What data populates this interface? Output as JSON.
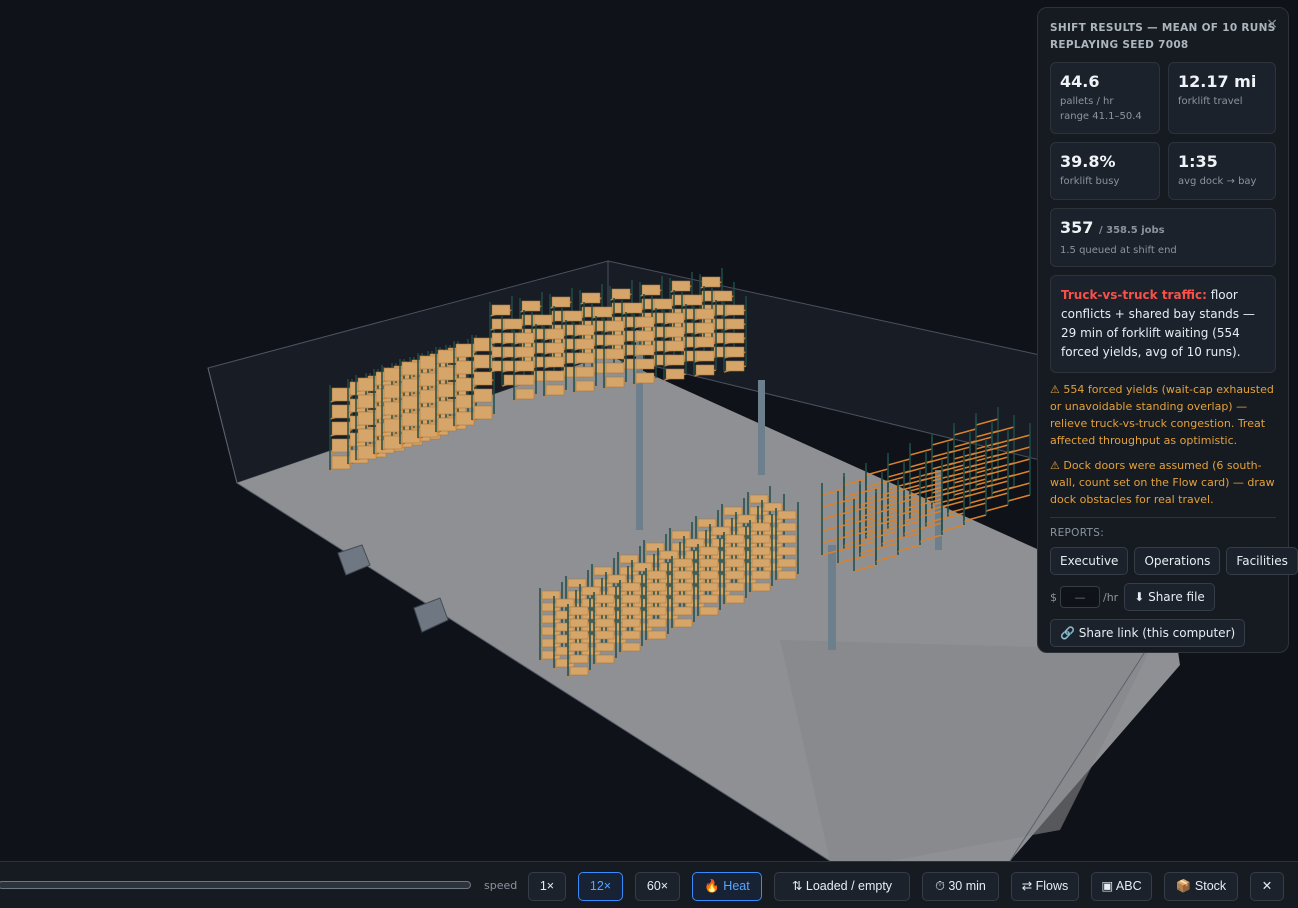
{
  "panel": {
    "close_label": "×",
    "title_line1": "SHIFT RESULTS — MEAN OF 10 RUNS",
    "title_line2": "REPLAYING SEED 7008",
    "stats": {
      "pallets_value": "44.6",
      "pallets_label": "pallets / hr",
      "pallets_range": "range 41.1–50.4",
      "travel_value": "12.17 mi",
      "travel_label": "forklift travel",
      "busy_value": "39.8%",
      "busy_label": "forklift busy",
      "dock_value": "1:35",
      "dock_label": "avg dock → bay",
      "jobs_value": "357",
      "jobs_total": "/ 358.5 jobs",
      "jobs_queued": "1.5 queued at shift end"
    },
    "traffic_heading": "Truck-vs-truck traffic:",
    "traffic_body": " floor conflicts + shared bay stands — 29 min of forklift waiting (554 forced yields, avg of 10 runs).",
    "warning1": "⚠ 554 forced yields (wait-cap exhausted or unavoidable standing overlap) — relieve truck-vs-truck congestion. Treat affected throughput as optimistic.",
    "warning2": "⚠ Dock doors were assumed (6 south-wall, count set on the Flow card) — draw dock obstacles for real travel.",
    "reports_label": "REPORTS:",
    "report_buttons": [
      "Executive",
      "Operations",
      "Facilities"
    ],
    "rate_prefix": "$",
    "rate_placeholder": "—",
    "rate_suffix": "/hr",
    "share_file_label": "⬇ Share file",
    "share_link_label": "🔗 Share link (this computer)"
  },
  "toolbar": {
    "speed_label": "speed",
    "speed_1x": "1×",
    "speed_12x": "12×",
    "speed_60x": "60×",
    "heat_label": "🔥 Heat",
    "loaded_label": "⇅ Loaded / empty",
    "duration_label": "⏱ 30 min",
    "flows_label": "⇄ Flows",
    "abc_label": "▣ ABC",
    "stock_label": "📦 Stock",
    "close_label": "✕",
    "active_speed": "12×"
  },
  "colors": {
    "accent": "#58a6ff",
    "warning": "#e3a13a",
    "alert": "#f85149",
    "rack_frame": "#1f4d48",
    "rack_beam": "#d9822b",
    "pallet": "#d6a56a"
  }
}
